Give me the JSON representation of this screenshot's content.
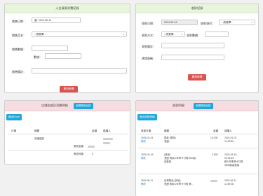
{
  "left_form": {
    "title": "入金資源消費紀錄",
    "date_label": "銷售日期：",
    "date_value": "2024-06-13",
    "item_label": "銷售品名：",
    "item_placeholder": "--請選擇--",
    "amount_label": "銷售數額：",
    "qty_label": "數據：",
    "note_label": "銷售備註：",
    "submit_label": "資料新增"
  },
  "right_form": {
    "title": "收款紀錄",
    "date_label": "收款日期：",
    "date_value": "2024-06-13",
    "project_label": "收款項目：",
    "project_placeholder": "--請選擇--",
    "method_label": "收款方式：",
    "method_placeholder": "--請選擇--",
    "amount_label": "收款數額：",
    "note_label": "收款備註：",
    "voucher_label": "憑證號碼：",
    "submit_label": "資料新增"
  },
  "left_table": {
    "title": "店鋪金額及消費明細",
    "title_button": "查看費用紀錄",
    "excel_button": "匯出Excel",
    "headers": [
      "日期",
      "摘要",
      "金額",
      "建檔人"
    ],
    "row": {
      "summary": "店鋪金額"
    },
    "summary_label": "應收金額：",
    "balance_label": "應收餘額：",
    "balance_value": "0"
  },
  "right_table": {
    "title": "收款明細",
    "title_button": "查看費用紀錄",
    "export_button": "匯出收款明細",
    "headers": [
      "收款日期",
      "摘要",
      "金額",
      "建檔人"
    ],
    "rows": [
      {
        "date": "2024-01-01",
        "action": "修改",
        "summary_lines": [
          "尾款 (預收)",
          "憑證："
        ],
        "amount": "10,000",
        "creator_lines": [
          "2024-01-01",
          "14:29:56"
        ]
      },
      {
        "date": "2024-03-19",
        "action": "修改",
        "summary_lines": [
          "(其他)",
          "憑證 費用1/年季卡付費1500起",
          "高數量"
        ],
        "amount": "3,500",
        "creator_lines": [
          "2024-03-19",
          "09:34:46",
          "鉤2/年季費卡付費",
          "3500起高數量"
        ]
      },
      {
        "date": "2024-06-11",
        "action": "修改",
        "summary_lines": [
          "自費物品 (其他)",
          "憑證 費用1/年季卡付費 第..."
        ],
        "amount": "",
        "creator_lines": [
          "2024-06-11",
          "11:49:28"
        ]
      }
    ]
  }
}
